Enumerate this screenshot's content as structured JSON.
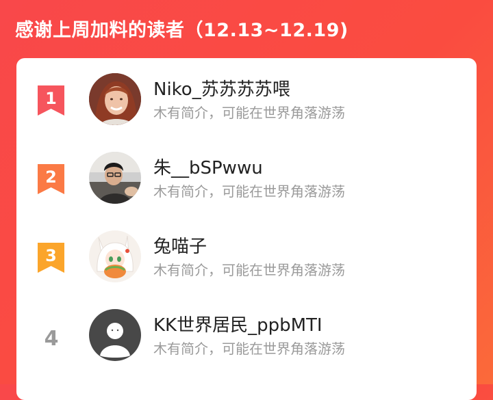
{
  "header": {
    "title": "感谢上周加料的读者（12.13~12.19)"
  },
  "colors": {
    "background_start": "#f9484a",
    "background_end": "#fb6a3a",
    "rank1": "#f6555d",
    "rank2": "#fb7a45",
    "rank3": "#fba52b",
    "rank_plain": "#9a9a9a"
  },
  "readers": [
    {
      "rank": "1",
      "name": "Niko_苏苏苏苏喂",
      "bio": "木有简介，可能在世界角落游荡",
      "avatar": "woman-photo"
    },
    {
      "rank": "2",
      "name": "朱__bSPwwu",
      "bio": "木有简介，可能在世界角落游荡",
      "avatar": "man-photo"
    },
    {
      "rank": "3",
      "name": "兔喵子",
      "bio": "木有简介，可能在世界角落游荡",
      "avatar": "anime-girl-illustration"
    },
    {
      "rank": "4",
      "name": "KK世界居民_ppbMTI",
      "bio": "木有简介，可能在世界角落游荡",
      "avatar": "default-user-silhouette"
    }
  ]
}
